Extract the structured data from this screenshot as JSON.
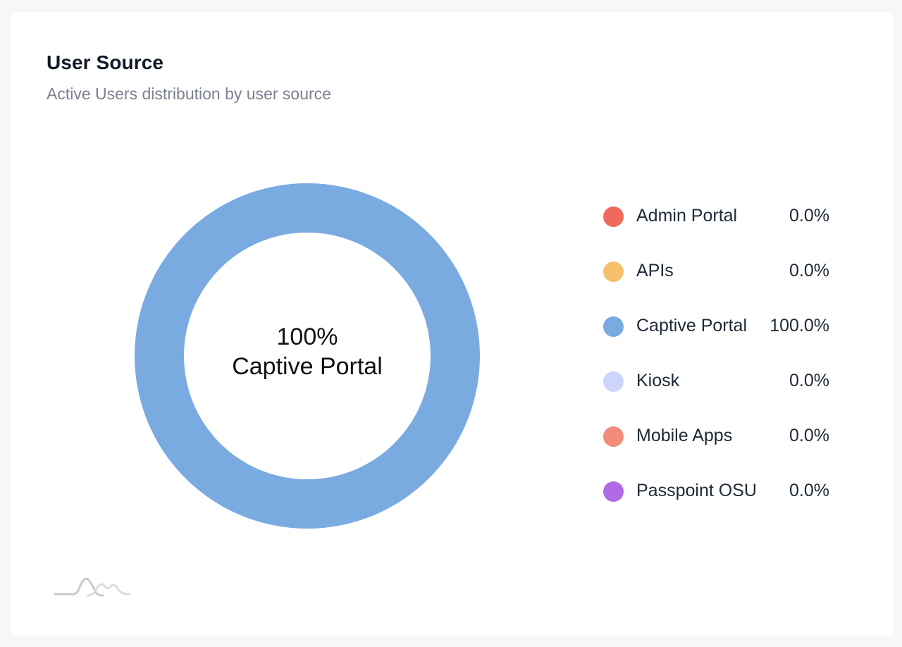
{
  "card": {
    "title": "User Source",
    "subtitle": "Active Users distribution by user source"
  },
  "chart_data": {
    "type": "pie",
    "variant": "donut",
    "center_label": {
      "value": "100%",
      "name": "Captive Portal"
    },
    "legend_placement": "right",
    "series": [
      {
        "name": "Admin Portal",
        "value": 0.0,
        "label": "0.0%",
        "color": "#ef6a5c"
      },
      {
        "name": "APIs",
        "value": 0.0,
        "label": "0.0%",
        "color": "#f5bf6b"
      },
      {
        "name": "Captive Portal",
        "value": 100.0,
        "label": "100.0%",
        "color": "#7aabe0"
      },
      {
        "name": "Kiosk",
        "value": 0.0,
        "label": "0.0%",
        "color": "#cdd5fb"
      },
      {
        "name": "Mobile Apps",
        "value": 0.0,
        "label": "0.0%",
        "color": "#f48c7b"
      },
      {
        "name": "Passpoint OSU",
        "value": 0.0,
        "label": "0.0%",
        "color": "#b06ae6"
      }
    ]
  }
}
